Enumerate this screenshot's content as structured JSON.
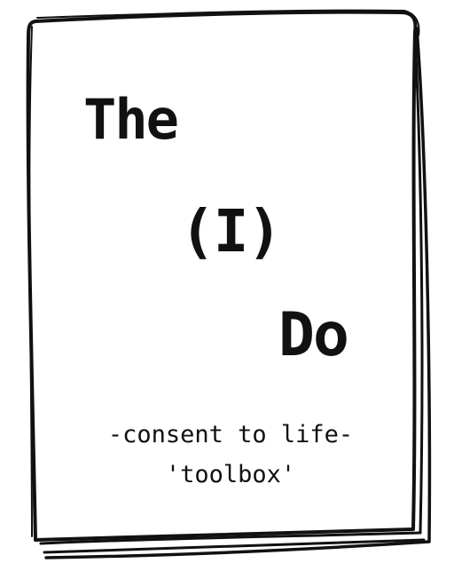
{
  "cover": {
    "title_line_1": "The",
    "title_line_2": "(I)",
    "title_line_3": "Do",
    "subtitle_line_1": "-consent to life-",
    "subtitle_line_2": "'toolbox'"
  },
  "colors": {
    "ink": "#111111",
    "paper": "#ffffff"
  }
}
